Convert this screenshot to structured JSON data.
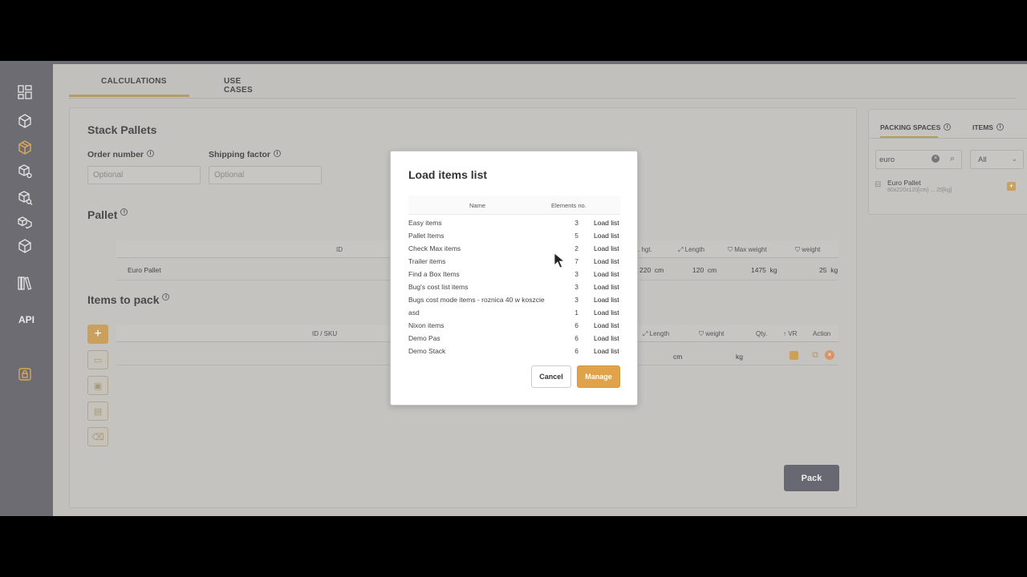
{
  "main_tabs": [
    {
      "label": "CALCULATIONS"
    },
    {
      "label": "USE CASES"
    }
  ],
  "sidebar": {
    "icons": [
      "dashboard-icon",
      "box-icon",
      "box-active-icon",
      "box-settings-icon",
      "box-search-icon",
      "boxes-icon",
      "box-export-icon",
      "library-icon"
    ],
    "api_label": "API",
    "lock_icon": "lock-icon"
  },
  "form": {
    "title": "Stack Pallets",
    "order_number": {
      "label": "Order number",
      "placeholder": "Optional"
    },
    "shipping_factor": {
      "label": "Shipping factor",
      "placeholder": "Optional"
    }
  },
  "pallet": {
    "title": "Pallet",
    "headers": {
      "id": "ID",
      "max_height": "x. hgt.",
      "length": "Length",
      "max_weight": "Max weight",
      "weight": "weight"
    },
    "row": {
      "name": "Euro Pallet",
      "height": "220",
      "height_unit": "cm",
      "length": "120",
      "length_unit": "cm",
      "max_weight": "1475",
      "max_weight_unit": "kg",
      "weight": "25",
      "weight_unit": "kg"
    }
  },
  "items": {
    "title": "Items to pack",
    "headers": {
      "id": "ID / SKU",
      "length": "Length",
      "weight": "weight",
      "qty": "Qty.",
      "vr": "VR",
      "action": "Action"
    },
    "row": {
      "length_unit": "cm",
      "weight_unit": "kg"
    }
  },
  "pack_button": "Pack",
  "right_panel": {
    "tabs": [
      {
        "label": "PACKING SPACES"
      },
      {
        "label": "ITEMS"
      }
    ],
    "search_value": "euro",
    "filter_value": "All",
    "result": {
      "name": "Euro Pallet",
      "detail": "80x220x120[cm] ... 25[kg]"
    }
  },
  "dialog": {
    "title": "Load items list",
    "headers": {
      "name": "Name",
      "elements": "Elements no."
    },
    "rows": [
      {
        "name": "Easy items",
        "count": "3",
        "action": "Load list"
      },
      {
        "name": "Pallet Items",
        "count": "5",
        "action": "Load list"
      },
      {
        "name": "Check Max items",
        "count": "2",
        "action": "Load list"
      },
      {
        "name": "Trailer items",
        "count": "7",
        "action": "Load list"
      },
      {
        "name": "Find a Box Items",
        "count": "3",
        "action": "Load list"
      },
      {
        "name": "Bug's cost list items",
        "count": "3",
        "action": "Load list"
      },
      {
        "name": "Bugs cost mode items - roznica 40 w koszcie",
        "count": "3",
        "action": "Load list"
      },
      {
        "name": "asd",
        "count": "1",
        "action": "Load list"
      },
      {
        "name": "Nixon items",
        "count": "6",
        "action": "Load list"
      },
      {
        "name": "Demo Pas",
        "count": "6",
        "action": "Load list"
      },
      {
        "name": "Demo Stack",
        "count": "6",
        "action": "Load list"
      }
    ],
    "cancel_label": "Cancel",
    "manage_label": "Manage"
  },
  "colors": {
    "accent": "#e0a24a",
    "sidebar": "#6c6c72",
    "pack_button": "#686872"
  }
}
